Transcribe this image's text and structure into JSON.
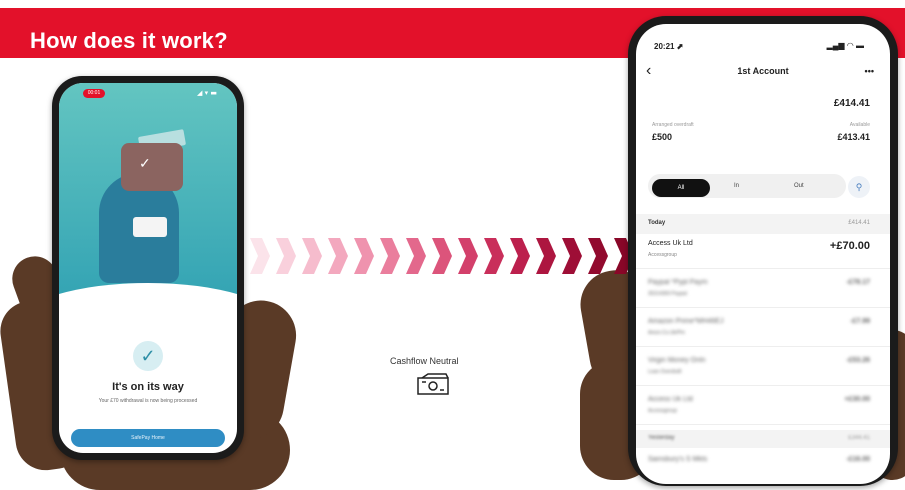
{
  "banner": {
    "title": "How does it work?",
    "bg_color": "#e3112a"
  },
  "left_phone": {
    "recording_badge": "00:01",
    "status_icons": "◢ ▾ ▬",
    "heading": "It's on its way",
    "subtext": "Your £70 withdrawal is now being processed",
    "button_label": "SafePay Home"
  },
  "center": {
    "label": "Cashflow Neutral",
    "icon": "cash-note-icon",
    "arrow_colors": [
      "#fbe3ea",
      "#f9d0dc",
      "#f6bccd",
      "#f3a8be",
      "#ef93ae",
      "#ea7e9d",
      "#e3688c",
      "#dc547b",
      "#d3406b",
      "#c92f5b",
      "#bc204d",
      "#ad1640",
      "#9e0e36",
      "#920a2e",
      "#890728"
    ]
  },
  "right_phone": {
    "time": "20:21 ⬈",
    "signal": "▂▄▆ ◠ ▬",
    "back_icon": "‹",
    "title": "1st Account",
    "more_icon": "•••",
    "balance": "£414.41",
    "overdraft_label": "Arranged overdraft",
    "overdraft_value": "£500",
    "available_label": "Available",
    "available_value": "£413.41",
    "filters": [
      "All",
      "In",
      "Out"
    ],
    "today_label": "Today",
    "today_amount": "£414.41",
    "transactions": [
      {
        "name": "Access Uk Ltd",
        "sub": "Accessgroup",
        "amount": "+£70.00",
        "blurred": false
      },
      {
        "name": "Paypal *Pypl Paym",
        "sub": "35314369 Paypal",
        "amount": "-£78.17",
        "blurred": true
      },
      {
        "name": "Amazon Prime*MH46EJ",
        "sub": "Amzn.Co.Uk/Pm",
        "amount": "-£7.99",
        "blurred": true
      },
      {
        "name": "Virgin Money Onln",
        "sub": "Loan Overdraft",
        "amount": "-£53.26",
        "blurred": true
      },
      {
        "name": "Access Uk Ltd",
        "sub": "Accessgroup",
        "amount": "+£30.00",
        "blurred": true
      }
    ],
    "yesterday_label": "Yesterday",
    "yesterday_amount": "£344.41",
    "last_row": {
      "name": "Sainsbury's S Mkts",
      "amount": "-£16.00"
    }
  }
}
